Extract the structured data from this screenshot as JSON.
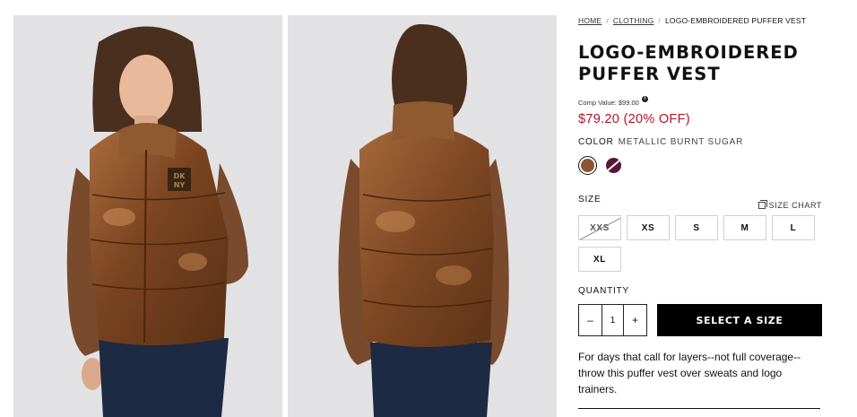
{
  "breadcrumb": {
    "home": "HOME",
    "category": "CLOTHING",
    "current": "LOGO-EMBROIDERED PUFFER VEST"
  },
  "product": {
    "title_line1": "LOGO-EMBROIDERED",
    "title_line2": "PUFFER VEST",
    "comp_value": "Comp Value: $99.00",
    "info_glyph": "i",
    "price": "$79.20 (20% OFF)",
    "description": "For days that call for layers--not full coverage--throw this puffer vest over sweats and logo trainers."
  },
  "photos": {
    "front_logo": "DK\nNY",
    "icon_front": "model-front-photo",
    "icon_back": "model-back-photo"
  },
  "color": {
    "label": "COLOR",
    "selected_name": "METALLIC BURNT SUGAR",
    "swatches": [
      {
        "name": "metallic-burnt-sugar",
        "hex": "#8a5530",
        "selected": true
      },
      {
        "name": "burgundy",
        "hex": "#5a1538",
        "selected": false
      }
    ]
  },
  "size": {
    "label": "SIZE",
    "chart_label": "SIZE CHART",
    "options": [
      {
        "label": "XXS",
        "available": false
      },
      {
        "label": "XS",
        "available": true
      },
      {
        "label": "S",
        "available": true
      },
      {
        "label": "M",
        "available": true
      },
      {
        "label": "L",
        "available": true
      },
      {
        "label": "XL",
        "available": true
      }
    ]
  },
  "quantity": {
    "label": "QUANTITY",
    "minus": "–",
    "value": "1",
    "plus": "+"
  },
  "cta": {
    "label": "SELECT A SIZE"
  },
  "colors": {
    "price_red": "#b4142a",
    "cta_bg": "#000000",
    "photo_bg": "#e2e2e4"
  }
}
